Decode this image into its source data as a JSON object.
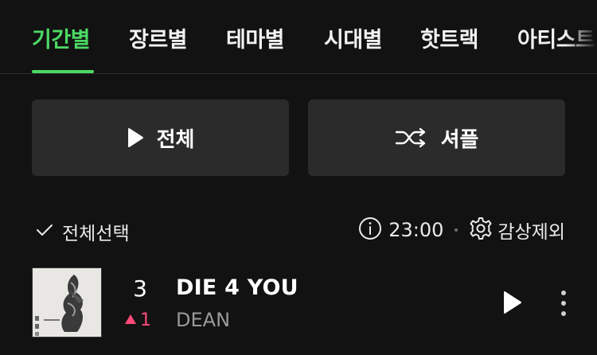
{
  "tabs": [
    {
      "label": "기간별",
      "active": true
    },
    {
      "label": "장르별",
      "active": false
    },
    {
      "label": "테마별",
      "active": false
    },
    {
      "label": "시대별",
      "active": false
    },
    {
      "label": "핫트랙",
      "active": false
    },
    {
      "label": "아티스트",
      "active": false
    }
  ],
  "actions": {
    "play_all_label": "전체",
    "shuffle_label": "셔플"
  },
  "selection": {
    "select_all_label": "전체선택",
    "duration": "23:00",
    "exclude_label": "감상제외"
  },
  "tracks": [
    {
      "rank": "3",
      "rank_change": "1",
      "rank_direction": "up",
      "title": "DIE 4 YOU",
      "artist": "DEAN"
    }
  ],
  "colors": {
    "accent": "#4cd964",
    "rank_up": "#ff4b7a",
    "background": "#121212",
    "button_bg": "#2b2b2b"
  },
  "icons": {
    "play_all": "play-icon",
    "shuffle": "shuffle-icon",
    "select": "check-icon",
    "info": "info-icon",
    "settings": "gear-icon",
    "rank_up": "triangle-up-icon",
    "track_play": "play-icon",
    "track_more": "more-vertical-icon"
  }
}
